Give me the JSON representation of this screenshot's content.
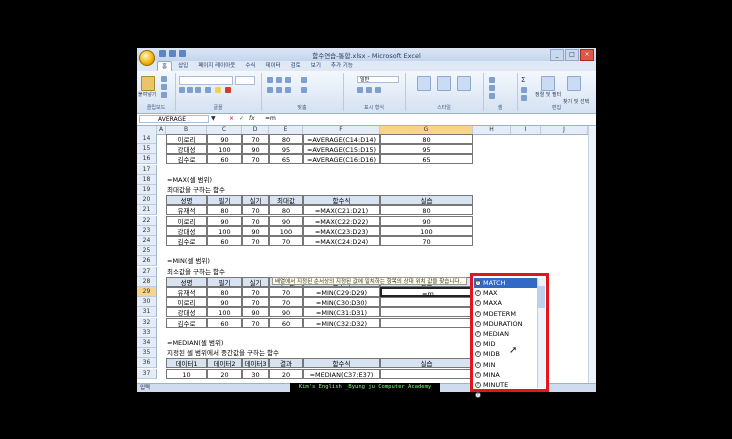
{
  "window": {
    "title": "함수연습-통합.xlsx - Microsoft Excel",
    "controls": [
      "_",
      "□",
      "×"
    ]
  },
  "ribbon": {
    "tabs": [
      "홈",
      "삽입",
      "페이지 레이아웃",
      "수식",
      "데이터",
      "검토",
      "보기",
      "추가 기능"
    ],
    "active_tab": "홈",
    "groups": [
      "클립보드",
      "글꼴",
      "맞춤",
      "표시 형식",
      "스타일",
      "셀",
      "편집"
    ],
    "paste_label": "붙여넣기",
    "number_format": "일반",
    "sort_filter_label": "정렬 및 필터",
    "find_select_label": "찾기 및 선택"
  },
  "formula_bar": {
    "name_box": "AVERAGE",
    "content": "=m",
    "buttons": [
      "▼",
      "×",
      "✓",
      "fx"
    ]
  },
  "columns": [
    "A",
    "B",
    "C",
    "D",
    "E",
    "F",
    "G",
    "H",
    "I",
    "J"
  ],
  "selected_column": "G",
  "selected_row": "29",
  "rows": [
    {
      "n": "14",
      "B": "이로리",
      "C": "90",
      "D": "70",
      "E": "80",
      "F": "=AVERAGE(C14:D14)",
      "G": "80"
    },
    {
      "n": "15",
      "B": "강대성",
      "C": "100",
      "D": "90",
      "E": "95",
      "F": "=AVERAGE(C15:D15)",
      "G": "95"
    },
    {
      "n": "16",
      "B": "김수로",
      "C": "60",
      "D": "70",
      "E": "65",
      "F": "=AVERAGE(C16:D16)",
      "G": "65"
    },
    {
      "n": "17"
    },
    {
      "n": "18",
      "B": "=MAX(셀 범위)"
    },
    {
      "n": "19",
      "B": "최대값을 구하는 함수"
    },
    {
      "n": "20",
      "B": "성명",
      "C": "필기",
      "D": "실기",
      "E": "최대값",
      "F": "함수식",
      "G": "실습"
    },
    {
      "n": "21",
      "B": "유재석",
      "C": "80",
      "D": "70",
      "E": "80",
      "F": "=MAX(C21:D21)",
      "G": "80"
    },
    {
      "n": "22",
      "B": "이로리",
      "C": "90",
      "D": "70",
      "E": "90",
      "F": "=MAX(C22:D22)",
      "G": "90"
    },
    {
      "n": "23",
      "B": "강대성",
      "C": "100",
      "D": "90",
      "E": "100",
      "F": "=MAX(C23:D23)",
      "G": "100"
    },
    {
      "n": "24",
      "B": "김수로",
      "C": "60",
      "D": "70",
      "E": "70",
      "F": "=MAX(C24:D24)",
      "G": "70"
    },
    {
      "n": "25"
    },
    {
      "n": "26",
      "B": "=MIN(셀 범위)"
    },
    {
      "n": "27",
      "B": "최소값을 구하는 함수"
    },
    {
      "n": "28",
      "B": "성명",
      "C": "필기",
      "D": "실기",
      "E": "최소값",
      "F": "함수식",
      "G": "실습"
    },
    {
      "n": "29",
      "B": "유재석",
      "C": "80",
      "D": "70",
      "E": "70",
      "F": "=MIN(C29:D29)",
      "G": "=m"
    },
    {
      "n": "30",
      "B": "이로리",
      "C": "90",
      "D": "70",
      "E": "70",
      "F": "=MIN(C30:D30)",
      "G": ""
    },
    {
      "n": "31",
      "B": "강대성",
      "C": "100",
      "D": "90",
      "E": "90",
      "F": "=MIN(C31:D31)",
      "G": ""
    },
    {
      "n": "32",
      "B": "김수로",
      "C": "60",
      "D": "70",
      "E": "60",
      "F": "=MIN(C32:D32)",
      "G": ""
    },
    {
      "n": "33"
    },
    {
      "n": "34",
      "B": "=MEDIAN(셀 범위)"
    },
    {
      "n": "35",
      "B": "지정된 셀 범위에서 중간값을 구하는 함수"
    },
    {
      "n": "36",
      "B": "데이터1",
      "C": "데이터2",
      "D": "데이터3",
      "E": "결과",
      "F": "함수식",
      "G": "실습"
    },
    {
      "n": "37",
      "B": "10",
      "C": "20",
      "D": "30",
      "E": "20",
      "F": "=MEDIAN(C37:E37)",
      "G": ""
    }
  ],
  "tooltip": "배열에서 지정된 순서상의 지정된 값에 일치하는 항목의 상대 위치 값을 찾습니다.",
  "autocomplete": {
    "items": [
      "MATCH",
      "MAX",
      "MAXA",
      "MDETERM",
      "MDURATION",
      "MEDIAN",
      "MID",
      "MIDB",
      "MIN",
      "MINA",
      "MINUTE",
      "MINVERSE"
    ],
    "selected": "MATCH"
  },
  "sheet_tabs": [
    "사칙함수",
    "논리함수",
    "텍스트함수",
    "통계함수",
    "수학과 삼각함수",
    "찾기와 참조함수",
    "데이터베이스함수"
  ],
  "status": "입력",
  "watermark": "Kim's English _Byung ju Computer Academy"
}
